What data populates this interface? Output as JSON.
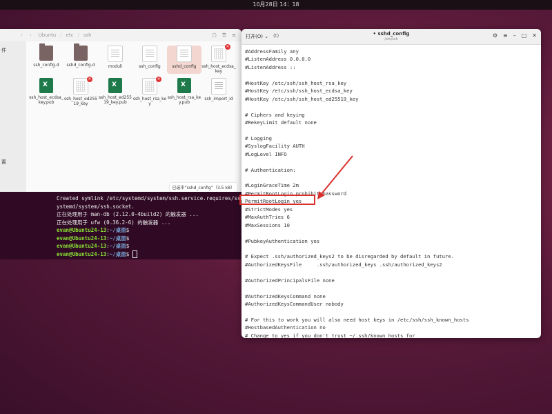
{
  "topbar": {
    "clock": "10月28日  14：18"
  },
  "files": {
    "nav_back": "‹",
    "nav_fwd": "›",
    "breadcrumb": [
      "Ubuntu",
      "etc",
      "ssh"
    ],
    "sidebar": [
      "件",
      "",
      "",
      "",
      "",
      "置"
    ],
    "items": [
      {
        "name": "ssh_config.d",
        "kind": "folder",
        "badge": false,
        "selected": false
      },
      {
        "name": "sshd_config.d",
        "kind": "folder",
        "badge": false,
        "selected": false
      },
      {
        "name": "moduli",
        "kind": "doc",
        "badge": false,
        "selected": false
      },
      {
        "name": "ssh_config",
        "kind": "doc",
        "badge": false,
        "selected": false
      },
      {
        "name": "sshd_config",
        "kind": "doc",
        "badge": false,
        "selected": true
      },
      {
        "name": "ssh_host_ecdsa_key",
        "kind": "gridf",
        "badge": true,
        "selected": false
      },
      {
        "name": "ssh_host_ecdsa_key.pub",
        "kind": "sheet",
        "badge": false,
        "selected": false
      },
      {
        "name": "ssh_host_ed25519_key",
        "kind": "gridf",
        "badge": true,
        "selected": false
      },
      {
        "name": "ssh_host_ed25519_key.pub",
        "kind": "sheet",
        "badge": false,
        "selected": false
      },
      {
        "name": "ssh_host_rsa_key",
        "kind": "gridf",
        "badge": true,
        "selected": false
      },
      {
        "name": "ssh_host_rsa_key.pub",
        "kind": "sheet",
        "badge": false,
        "selected": false
      },
      {
        "name": "ssh_import_id",
        "kind": "doc",
        "badge": false,
        "selected": false
      }
    ],
    "status": "已选中“sshd_config”（3.5 kB）"
  },
  "terminal": {
    "lines": [
      "Created symlink /etc/systemd/system/ssh.service.requires/ssh.socket",
      "ystemd/system/ssh.socket.",
      "正在处理用于 man-db (2.12.0-4build2) 的触发器 ...",
      "正在处理用于 ufw (0.36.2-6) 的触发器 ..."
    ],
    "prompt_user": "evan@Ubuntu24-13",
    "prompt_path": "~/桌面",
    "prompt_count": 4
  },
  "editor": {
    "open_label": "打开(O) ⌄",
    "new_tab": "(t)",
    "title": "• sshd_config",
    "subtitle": "/etc/ssh",
    "lines": [
      "#AddressFamily any",
      "#ListenAddress 0.0.0.0",
      "#ListenAddress ::",
      "",
      "#HostKey /etc/ssh/ssh_host_rsa_key",
      "#HostKey /etc/ssh/ssh_host_ecdsa_key",
      "#HostKey /etc/ssh/ssh_host_ed25519_key",
      "",
      "# Ciphers and keying",
      "#RekeyLimit default none",
      "",
      "# Logging",
      "#SyslogFacility AUTH",
      "#LogLevel INFO",
      "",
      "# Authentication:",
      "",
      "#LoginGraceTime 2m",
      "#PermitRootLogin prohibit-password",
      "PermitRootLogin yes",
      "#StrictModes yes",
      "#MaxAuthTries 6",
      "#MaxSessions 10",
      "",
      "#PubkeyAuthentication yes",
      "",
      "# Expect .ssh/authorized_keys2 to be disregarded by default in future.",
      "#AuthorizedKeysFile     .ssh/authorized_keys .ssh/authorized_keys2",
      "",
      "#AuthorizedPrincipalsFile none",
      "",
      "#AuthorizedKeysCommand none",
      "#AuthorizedKeysCommandUser nobody",
      "",
      "# For this to work you will also need host keys in /etc/ssh/ssh_known_hosts",
      "#HostbasedAuthentication no",
      "# Change to yes if you don't trust ~/.ssh/known_hosts for"
    ]
  },
  "colors": {
    "highlight": "#d9302c",
    "terminal_bg": "#300a24",
    "desktop": "#5a1a3a"
  }
}
